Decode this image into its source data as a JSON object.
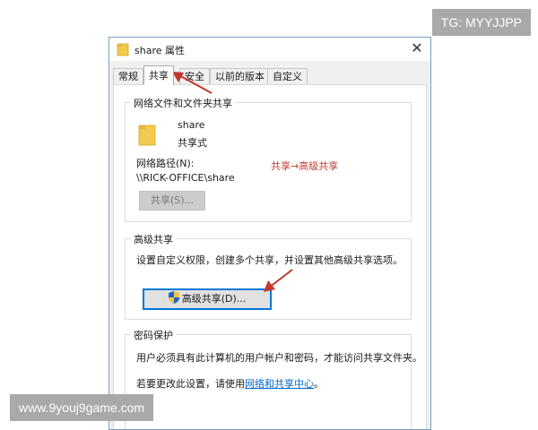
{
  "watermarks": {
    "top_right": "TG: MYYJJPP",
    "bottom_left": "www.9youj9game.com"
  },
  "dialog": {
    "title": "share 属性",
    "close_glyph": "✕",
    "tabs": [
      "常规",
      "共享",
      "安全",
      "以前的版本",
      "自定义"
    ],
    "active_tab": "共享"
  },
  "network_share": {
    "legend": "网络文件和文件夹共享",
    "share_name": "share",
    "share_state": "共享式",
    "path_label": "网络路径(N):",
    "path_value": "\\\\RICK-OFFICE\\share",
    "share_button": "共享(S)..."
  },
  "annotation": "共享→高级共享",
  "advanced_share": {
    "legend": "高级共享",
    "description": "设置自定义权限，创建多个共享，并设置其他高级共享选项。",
    "button": "高级共享(D)..."
  },
  "password_protect": {
    "legend": "密码保护",
    "description": "用户必须具有此计算机的用户帐户和密码，才能访问共享文件夹。",
    "change_prefix": "若要更改此设置，请使用",
    "change_link": "网络和共享中心",
    "change_suffix": "。"
  },
  "colors": {
    "annotation_red": "#c0392b",
    "focus_blue": "#0078d7",
    "link_blue": "#0066cc",
    "folder_yellow": "#f2c94c"
  },
  "icons": [
    "folder-icon",
    "shield-icon",
    "close-icon"
  ]
}
